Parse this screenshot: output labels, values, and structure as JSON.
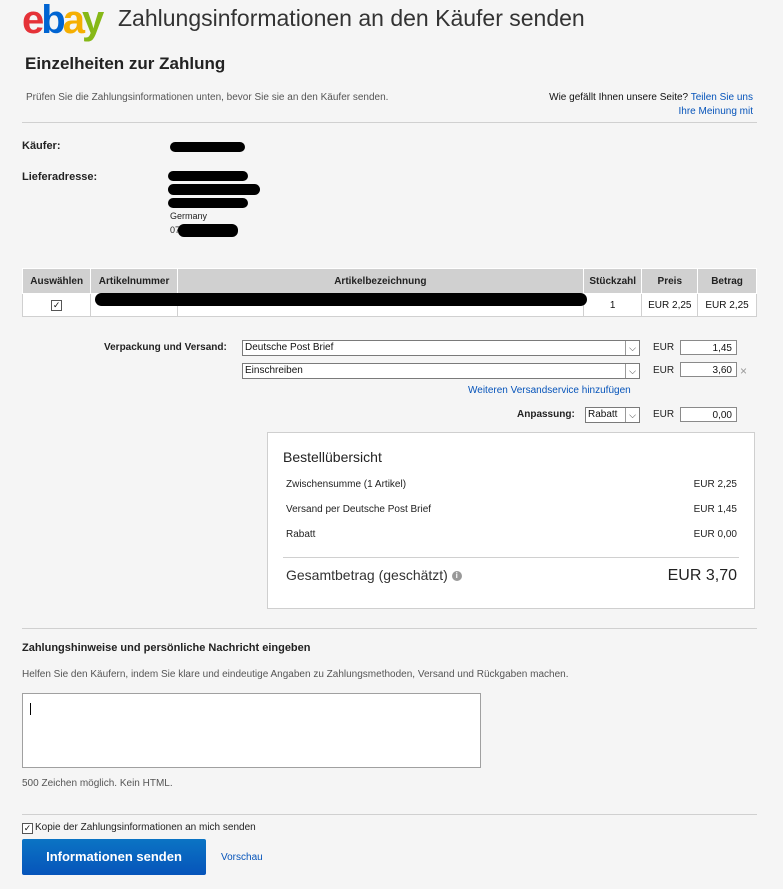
{
  "header": {
    "logo_letters": [
      "e",
      "b",
      "a",
      "y"
    ],
    "title": "Zahlungsinformationen an den Käufer senden"
  },
  "page": {
    "title": "Einzelheiten zur Zahlung",
    "subtitle": "Prüfen Sie die Zahlungsinformationen unten, bevor Sie sie an den Käufer senden.",
    "feedback_question": "Wie gefällt Ihnen unsere Seite?",
    "feedback_link_1": "Teilen Sie uns",
    "feedback_link_2": "Ihre Meinung mit"
  },
  "buyer": {
    "buyer_label": "Käufer:",
    "address_label": "Lieferadresse:",
    "country": "Germany",
    "phone_prefix": "07"
  },
  "table": {
    "headers": [
      "Auswählen",
      "Artikelnummer",
      "Artikelbezeichnung",
      "Stückzahl",
      "Preis",
      "Betrag"
    ],
    "row": {
      "checked": "✓",
      "quantity": "1",
      "price": "EUR 2,25",
      "amount": "EUR 2,25"
    }
  },
  "shipping": {
    "label": "Verpackung und Versand:",
    "service1": "Deutsche Post Brief",
    "service2": "Einschreiben",
    "currency": "EUR",
    "cost1": "1,45",
    "cost2": "3,60",
    "remove_icon": "×",
    "add_service_link": "Weiteren Versandservice hinzufügen",
    "adjust_label": "Anpassung:",
    "adjust_type": "Rabatt",
    "adjust_value": "0,00"
  },
  "summary": {
    "title": "Bestellübersicht",
    "subtotal_label": "Zwischensumme (1 Artikel)",
    "subtotal_value": "EUR 2,25",
    "shipping_label": "Versand per Deutsche Post Brief",
    "shipping_value": "EUR 1,45",
    "discount_label": "Rabatt",
    "discount_value": "EUR 0,00",
    "total_label": "Gesamtbetrag (geschätzt)",
    "total_value": "EUR 3,70",
    "info_icon": "i"
  },
  "message": {
    "title": "Zahlungshinweise und persönliche Nachricht eingeben",
    "help": "Helfen Sie den Käufern, indem Sie klare und eindeutige Angaben zu Zahlungsmethoden, Versand und Rückgaben machen.",
    "value": "",
    "limit_note": "500 Zeichen möglich. Kein HTML."
  },
  "footer": {
    "copy_checkbox_label": "Kopie der Zahlungsinformationen an mich senden",
    "copy_checked": "✓",
    "send_button": "Informationen senden",
    "preview_link": "Vorschau"
  },
  "colors": {
    "link": "#0654ba",
    "button": "#0654ba",
    "ebay_e": "#e53238",
    "ebay_b": "#0064d2",
    "ebay_a": "#f5af02",
    "ebay_y": "#86b817"
  }
}
